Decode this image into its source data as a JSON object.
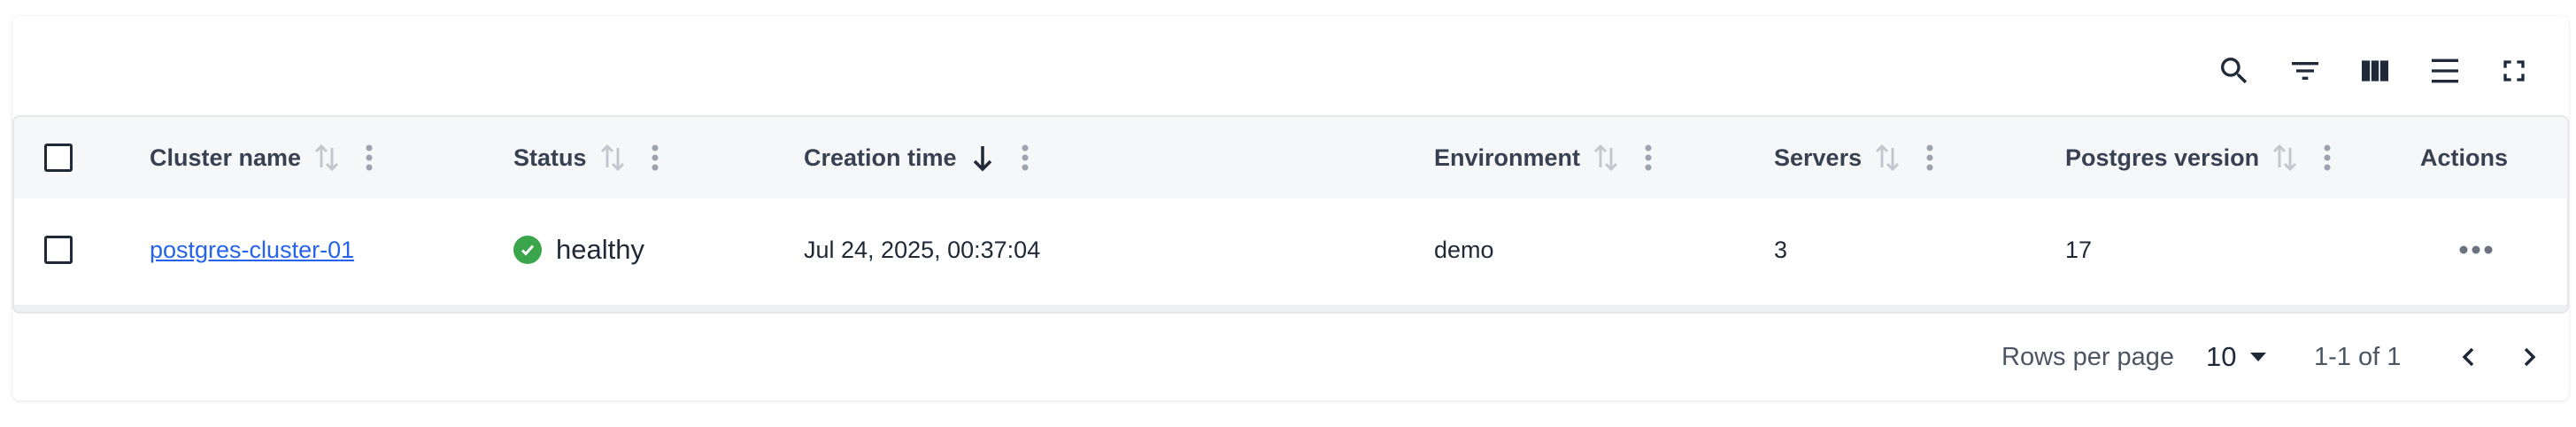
{
  "toolbar": {
    "icons": [
      "search-icon",
      "filter-icon",
      "columns-icon",
      "density-icon",
      "fullscreen-icon"
    ]
  },
  "table": {
    "columns": {
      "cluster_name": "Cluster name",
      "status": "Status",
      "creation_time": "Creation time",
      "environment": "Environment",
      "servers": "Servers",
      "postgres_version": "Postgres version",
      "actions": "Actions"
    },
    "rows": [
      {
        "cluster_name": "postgres-cluster-01",
        "status": "healthy",
        "creation_time": "Jul 24, 2025, 00:37:04",
        "environment": "demo",
        "servers": "3",
        "postgres_version": "17"
      }
    ],
    "sorted_column": "creation_time",
    "sort_direction": "descending"
  },
  "pagination": {
    "rows_per_page_label": "Rows per page",
    "rows_per_page_value": "10",
    "range_text": "1-1 of 1"
  },
  "colors": {
    "healthy": "#3aa54a",
    "link": "#2563eb",
    "header_bg": "#f6f7f9"
  }
}
